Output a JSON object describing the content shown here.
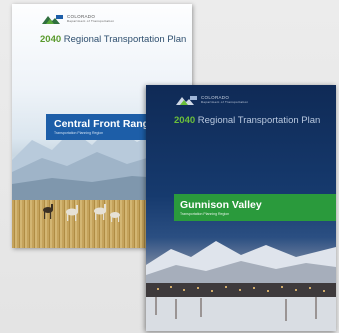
{
  "back_cover": {
    "logo_text_top": "COLORADO",
    "logo_text_bottom": "Department of Transportation",
    "year": "2040",
    "plan_title": "Regional Transportation Plan",
    "region_name": "Central Front Range",
    "region_subtitle": "Transportation Planning Region",
    "accent_color": "#1d5ea8"
  },
  "front_cover": {
    "logo_text_top": "COLORADO",
    "logo_text_bottom": "Department of Transportation",
    "year": "2040",
    "plan_title": "Regional Transportation Plan",
    "region_name": "Gunnison Valley",
    "region_subtitle": "Transportation Planning Region",
    "accent_color": "#2a9a3c"
  },
  "icons": [
    "cdot-logo-icon",
    "mountains-icon",
    "horses-icon",
    "town-lights-icon"
  ]
}
